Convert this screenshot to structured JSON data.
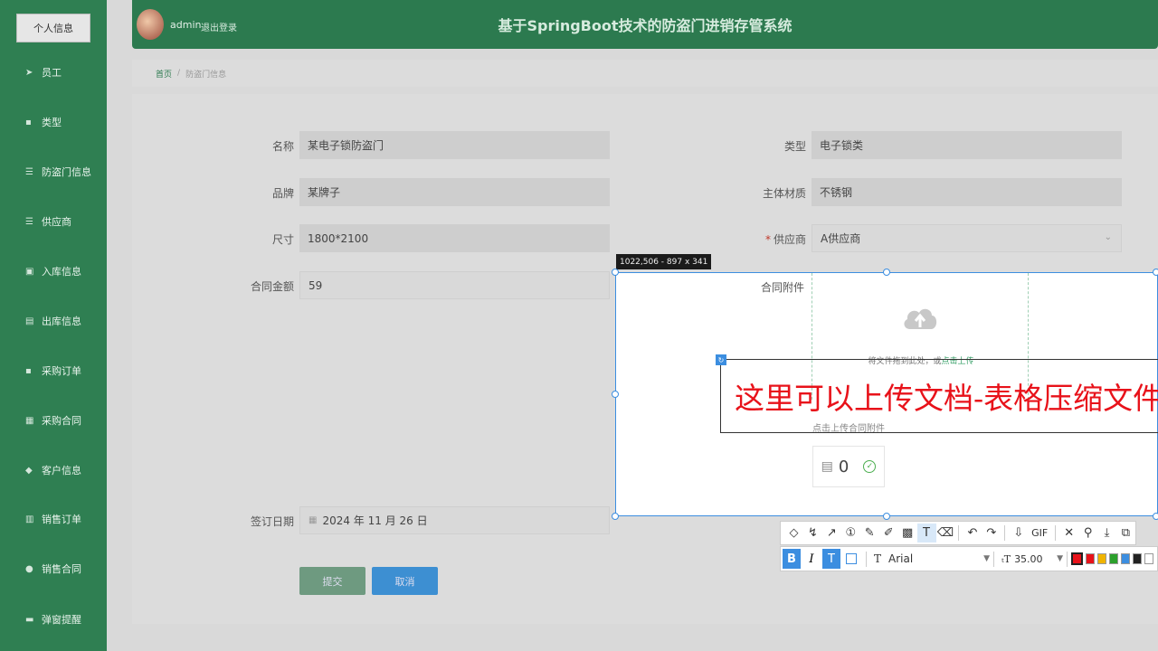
{
  "sidebar": {
    "profile": "个人信息",
    "items": [
      {
        "label": "员工",
        "icon": "send-icon",
        "glyph": "➤"
      },
      {
        "label": "类型",
        "icon": "file-icon",
        "glyph": "▪"
      },
      {
        "label": "防盗门信息",
        "icon": "sliders-icon",
        "glyph": "☰"
      },
      {
        "label": "供应商",
        "icon": "list-icon",
        "glyph": "☰"
      },
      {
        "label": "入库信息",
        "icon": "lock-icon",
        "glyph": "▣"
      },
      {
        "label": "出库信息",
        "icon": "document-icon",
        "glyph": "▤"
      },
      {
        "label": "采购订单",
        "icon": "bookmark-icon",
        "glyph": "▪"
      },
      {
        "label": "采购合同",
        "icon": "grid-icon",
        "glyph": "▦"
      },
      {
        "label": "客户信息",
        "icon": "user-icon",
        "glyph": "◆"
      },
      {
        "label": "销售订单",
        "icon": "bar-chart-icon",
        "glyph": "▥"
      },
      {
        "label": "销售合同",
        "icon": "pin-icon",
        "glyph": "●"
      },
      {
        "label": "弹窗提醒",
        "icon": "folder-icon",
        "glyph": "▬"
      }
    ]
  },
  "header": {
    "username": "admin",
    "logout": "退出登录",
    "title": "基于SpringBoot技术的防盗门进销存管系统"
  },
  "breadcrumb": {
    "home": "首页",
    "sep": "/",
    "current": "防盗门信息"
  },
  "form": {
    "name": {
      "label": "名称",
      "value": "某电子锁防盗门"
    },
    "type": {
      "label": "类型",
      "value": "电子锁类"
    },
    "brand": {
      "label": "品牌",
      "value": "某牌子"
    },
    "material": {
      "label": "主体材质",
      "value": "不锈钢"
    },
    "size": {
      "label": "尺寸",
      "value": "1800*2100"
    },
    "supplier": {
      "required": "*",
      "label": "供应商",
      "value": "A供应商"
    },
    "amount": {
      "label": "合同金额",
      "value": "59"
    },
    "attachment": {
      "label": "合同附件"
    },
    "sign_date": {
      "label": "签订日期",
      "value": "2024 年 11 月 26 日"
    }
  },
  "buttons": {
    "submit": "提交",
    "cancel": "取消"
  },
  "upload": {
    "hint_a": "将文件拖到此处，或",
    "hint_b": "点击上传",
    "tip": "点击上传合同附件",
    "file_count": "0"
  },
  "capture": {
    "dimensions": "1022,506 - 897 x 341",
    "annotation": "这里可以上传文档-表格压缩文件"
  },
  "editor": {
    "gif": "GIF",
    "bold": "B",
    "italic": "I",
    "font_name": "Arial",
    "font_size": "35.00",
    "colors": [
      "#e8121a",
      "#e8121a",
      "#f0b400",
      "#2ca02c",
      "#3c8ee0",
      "#222222",
      "#ffffff"
    ]
  }
}
